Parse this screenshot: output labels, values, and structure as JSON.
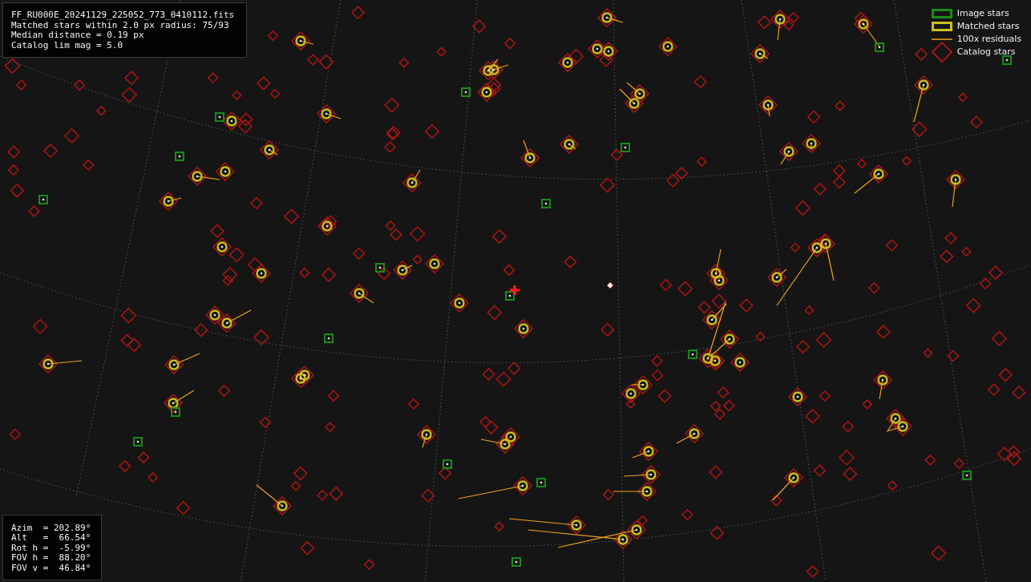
{
  "image_info": {
    "lines": [
      "FF_RU000E_20241129_225052_773_0410112.fits",
      "Matched stars within 2.0 px radius: 75/93",
      "Median distance = 0.19 px",
      "Catalog lim mag = 5.0"
    ]
  },
  "legend": [
    {
      "kind": "image",
      "label": "Image stars"
    },
    {
      "kind": "matched",
      "label": "Matched stars"
    },
    {
      "kind": "residual",
      "label": "100x residuals"
    },
    {
      "kind": "catalog",
      "label": "Catalog stars"
    }
  ],
  "pointing": {
    "lines": [
      "Azim  = 202.89°",
      "Alt   =  66.54°",
      "Rot h =  -5.99°",
      "FOV h =  88.20°",
      "FOV v =  46.84°"
    ]
  }
}
